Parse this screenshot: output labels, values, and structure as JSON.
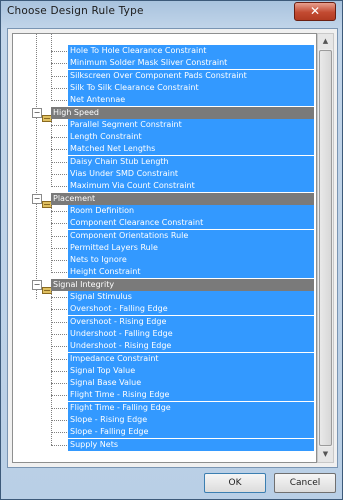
{
  "window": {
    "title": "Choose Design Rule Type",
    "close_label": "✕"
  },
  "tree": {
    "top_items": [
      "Hole To Hole Clearance Constraint",
      "Minimum Solder Mask Sliver Constraint",
      "Silkscreen Over Component Pads Constraint",
      "Silk To Silk Clearance Constraint",
      "Net Antennae"
    ],
    "categories": [
      {
        "name": "High Speed",
        "icon": "high-speed-icon",
        "items": [
          "Parallel Segment Constraint",
          "Length Constraint",
          "Matched Net Lengths",
          "Daisy Chain Stub Length",
          "Vias Under SMD Constraint",
          "Maximum Via Count Constraint"
        ]
      },
      {
        "name": "Placement",
        "icon": "placement-icon",
        "items": [
          "Room Definition",
          "Component Clearance Constraint",
          "Component Orientations Rule",
          "Permitted Layers Rule",
          "Nets to Ignore",
          "Height Constraint"
        ]
      },
      {
        "name": "Signal Integrity",
        "icon": "signal-integrity-icon",
        "items": [
          "Signal Stimulus",
          "Overshoot - Falling Edge",
          "Overshoot - Rising Edge",
          "Undershoot - Falling Edge",
          "Undershoot - Rising Edge",
          "Impedance Constraint",
          "Signal Top Value",
          "Signal Base Value",
          "Flight Time - Rising Edge",
          "Flight Time - Falling Edge",
          "Slope - Rising Edge",
          "Slope - Falling Edge",
          "Supply Nets"
        ]
      }
    ],
    "expander_symbol": "−"
  },
  "buttons": {
    "ok_label": "OK",
    "cancel_label": "Cancel"
  },
  "colors": {
    "selection": "#3399ff",
    "category_bg": "#7a7a7a",
    "title_bar": "#a9c3de"
  }
}
